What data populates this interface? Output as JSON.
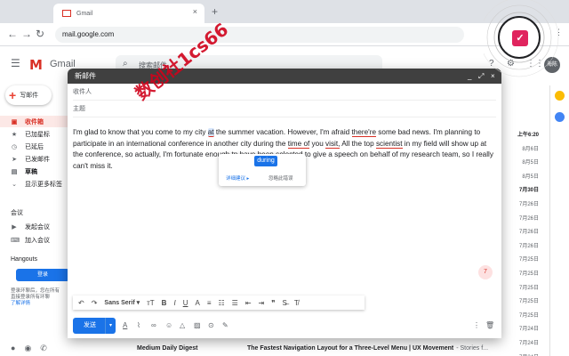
{
  "browser": {
    "tab_title": "Gmail",
    "tab_close": "×",
    "new_tab": "+",
    "url": "mail.google.com"
  },
  "gmail": {
    "logo_text": "Gmail",
    "search_placeholder": "搜索邮件",
    "avatar_text": "海陈",
    "compose_label": "写邮件",
    "sidebar": [
      {
        "label": "收件箱",
        "icon": "inbox-icon",
        "active": true
      },
      {
        "label": "已加星标",
        "icon": "star-icon"
      },
      {
        "label": "已延后",
        "icon": "clock-icon"
      },
      {
        "label": "已发邮件",
        "icon": "send-icon"
      },
      {
        "label": "草稿",
        "icon": "draft-icon"
      },
      {
        "label": "显示更多标签",
        "icon": "chevron-down-icon"
      }
    ],
    "meet_section": "会议",
    "meet_items": [
      {
        "label": "发起会议",
        "icon": "video-icon"
      },
      {
        "label": "加入会议",
        "icon": "keyboard-icon"
      }
    ],
    "hangouts_section": "Hangouts",
    "hangouts_button": "登录",
    "hangouts_note_1": "登录环聊后，您在所有",
    "hangouts_note_2": "直接登录所有环聊",
    "hangouts_note_3": "了解详情",
    "dates": [
      "上午6:20",
      "8月6日",
      "8月5日",
      "8月5日",
      "7月30日",
      "7月26日",
      "7月26日",
      "7月26日",
      "7月26日",
      "7月25日",
      "7月25日",
      "7月25日",
      "7月25日",
      "7月25日",
      "7月24日",
      "7月24日",
      "7月24日"
    ],
    "bottom_row": {
      "sender": "Medium Daily Digest",
      "subject": "The Fastest Navigation Layout for a Three-Level Menu | UX Movement",
      "snippet": "- Stories f..."
    }
  },
  "compose": {
    "title": "新邮件",
    "min": "_",
    "expand": "⤢",
    "close": "×",
    "to_label": "收件人",
    "subject_label": "主题",
    "body_parts": {
      "p1": "I'm glad to know that you come to my city ",
      "w_at": "at",
      "p2": " the su",
      "p3": "mmer vacation. However, I'm afraid ",
      "w_theres": "there're",
      "p4": " some bad news. I'm planning to participate in an international c",
      "p5": "onference in another city during the ",
      "w_time": "time of",
      "p6": " you ",
      "w_visit": "visit,",
      "p7": " All the top ",
      "w_scientist": "scientist",
      "p8": " in my field will show up at the co",
      "p9": "nference, so actually, I'm fortunate enough ",
      "w_tp": "tp",
      "p10": " have been selected to give a speech on behalf of my research tea",
      "p11": "m, so I really can't miss it."
    },
    "suggestion": "during",
    "suggest_detail": "详细建议 ▸",
    "suggest_ignore": "忽略此错误",
    "error_count": "7",
    "send_label": "发送",
    "send_caret": "▾",
    "font_label": "Sans Serif ▾",
    "watermark": "数创社1cs66"
  }
}
